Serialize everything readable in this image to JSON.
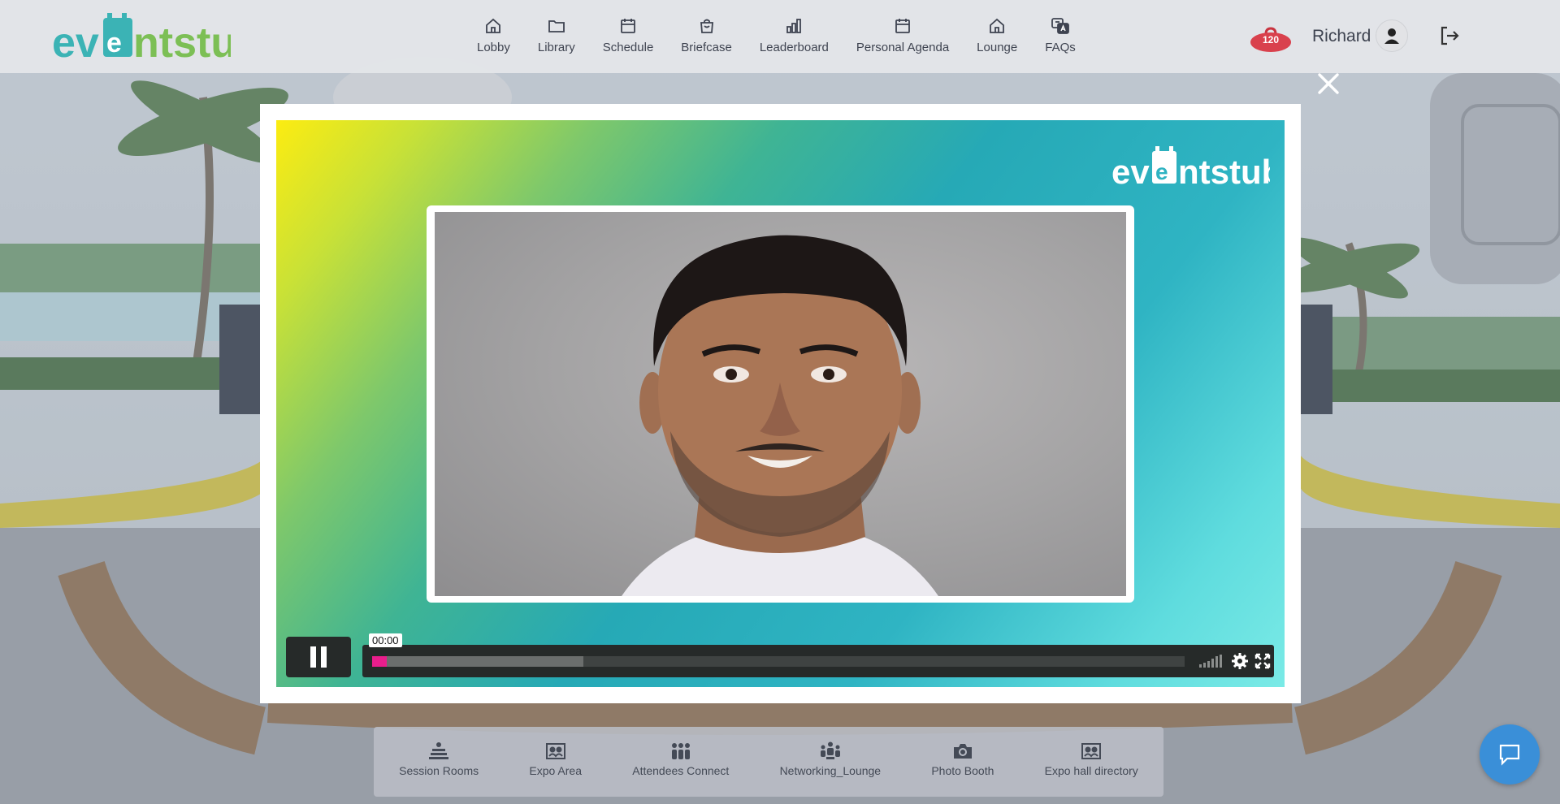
{
  "brand": {
    "logo_text": "eventstub"
  },
  "header": {
    "nav": [
      {
        "label": "Lobby",
        "icon": "home-icon"
      },
      {
        "label": "Library",
        "icon": "folder-icon"
      },
      {
        "label": "Schedule",
        "icon": "calendar-icon"
      },
      {
        "label": "Briefcase",
        "icon": "briefcase-icon"
      },
      {
        "label": "Leaderboard",
        "icon": "bar-chart-icon"
      },
      {
        "label": "Personal Agenda",
        "icon": "calendar-icon"
      },
      {
        "label": "Lounge",
        "icon": "home-icon"
      },
      {
        "label": "FAQs",
        "icon": "faq-icon"
      }
    ],
    "notification_count": "120",
    "user_name": "Richard"
  },
  "video": {
    "current_time": "00:00",
    "played_fraction": 0.018,
    "buffered_fraction": 0.26
  },
  "dock": {
    "items": [
      {
        "label": "Session Rooms",
        "icon": "session-rooms-icon"
      },
      {
        "label": "Expo Area",
        "icon": "expo-area-icon"
      },
      {
        "label": "Attendees Connect",
        "icon": "attendees-icon"
      },
      {
        "label": "Networking_Lounge",
        "icon": "networking-icon"
      },
      {
        "label": "Photo Booth",
        "icon": "camera-icon"
      },
      {
        "label": "Expo hall directory",
        "icon": "directory-icon"
      }
    ]
  },
  "colors": {
    "accent": "#3a8fd8",
    "progress": "#e91e8c",
    "badge": "#d9414d",
    "logo_teal": "#3bb3b5",
    "logo_lime": "#a8c73a"
  }
}
